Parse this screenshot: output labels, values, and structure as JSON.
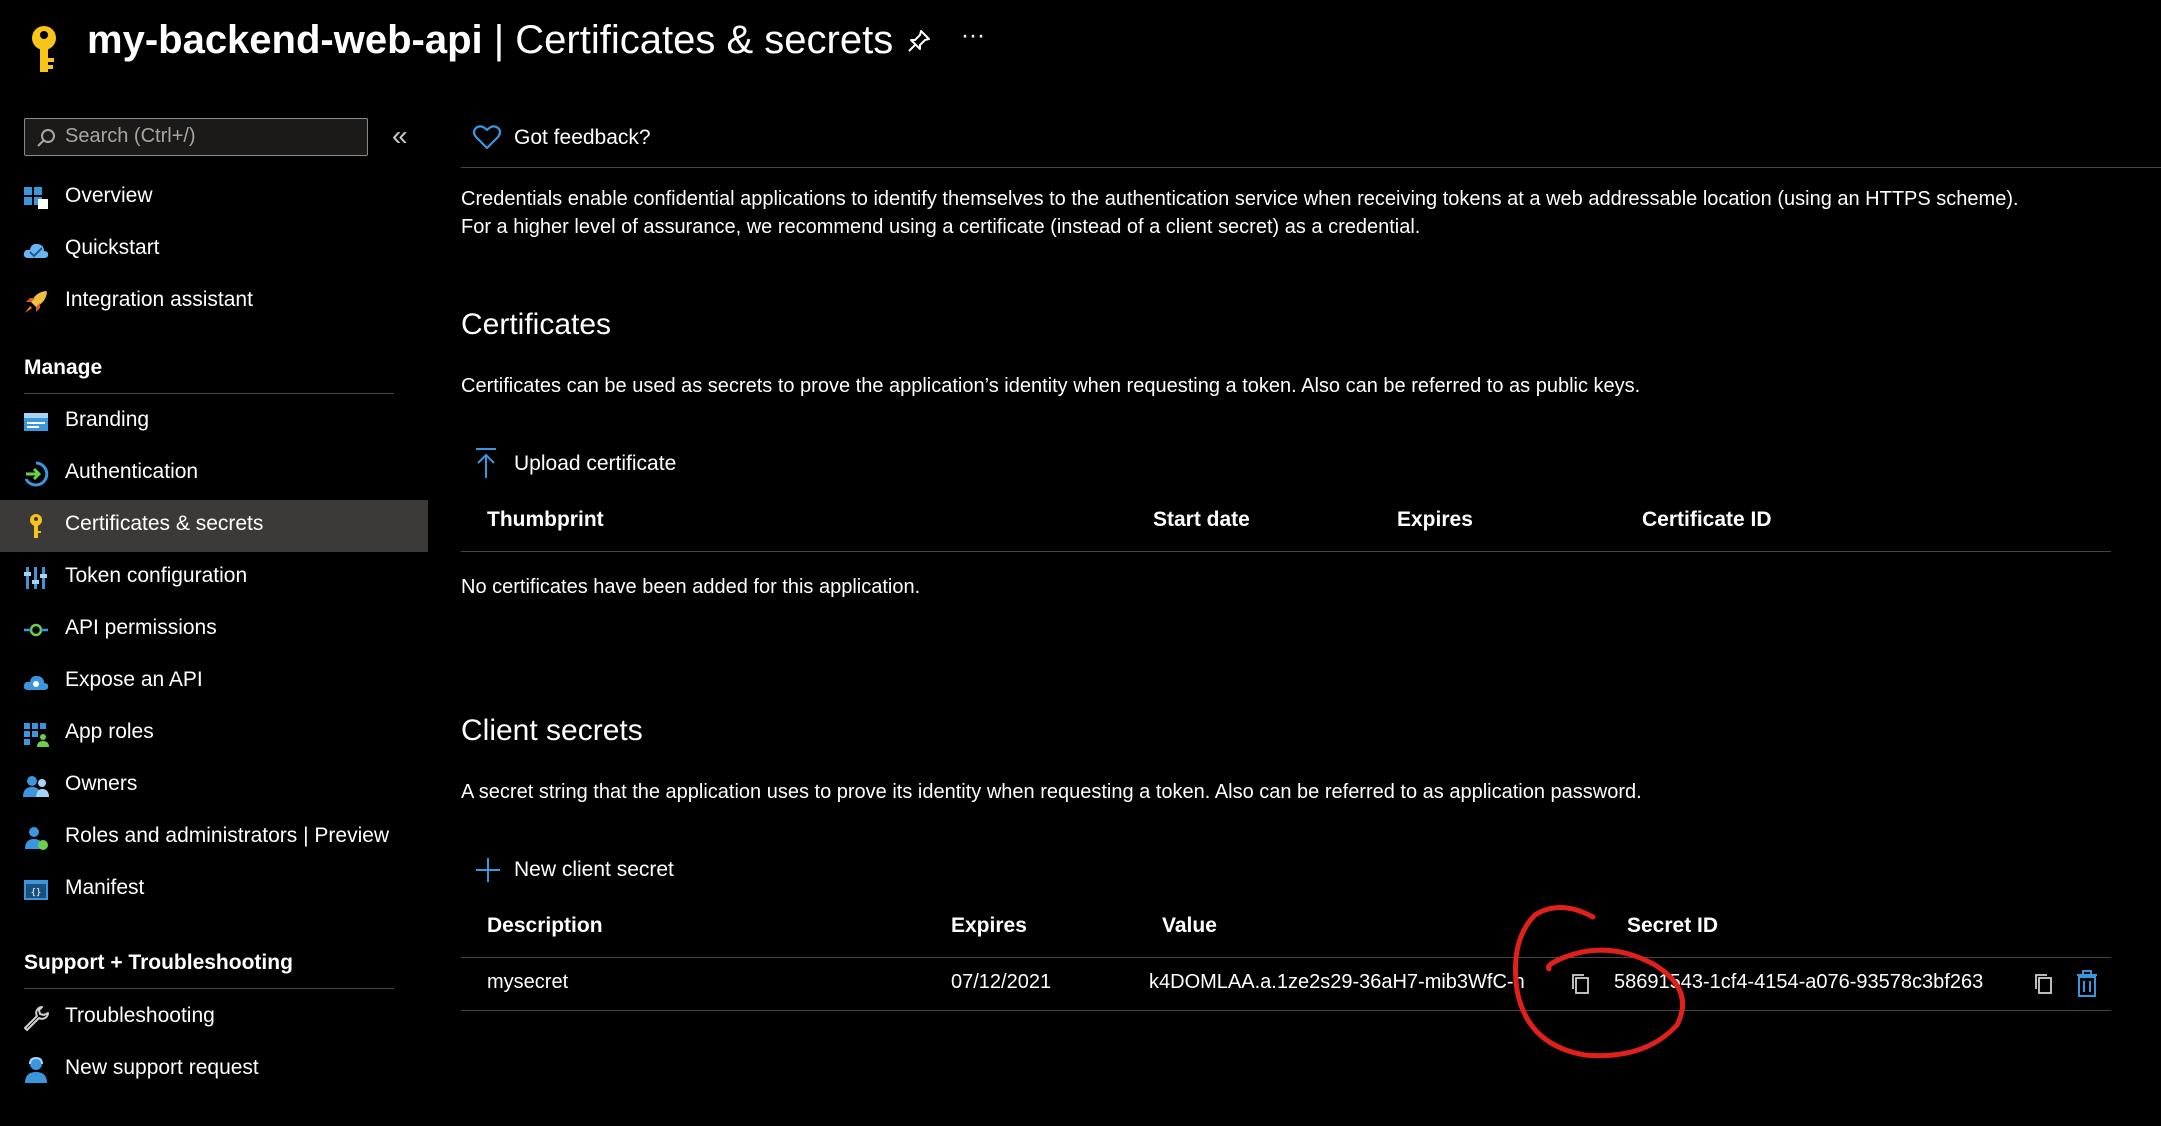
{
  "header": {
    "app_name": "my-backend-web-api",
    "separator": "|",
    "page_title": "Certificates & secrets",
    "pin_icon": "pin-icon",
    "more_icon": "more-icon",
    "more_glyph": "···"
  },
  "sidebar": {
    "search_placeholder": "Search (Ctrl+/)",
    "collapse_glyph": "«",
    "top_items": [
      {
        "label": "Overview",
        "icon": "overview-icon"
      },
      {
        "label": "Quickstart",
        "icon": "quickstart-cloud-icon"
      },
      {
        "label": "Integration assistant",
        "icon": "rocket-icon"
      }
    ],
    "manage_header": "Manage",
    "manage_items": [
      {
        "label": "Branding",
        "icon": "branding-icon"
      },
      {
        "label": "Authentication",
        "icon": "authentication-icon"
      },
      {
        "label": "Certificates & secrets",
        "icon": "key-icon",
        "active": true
      },
      {
        "label": "Token configuration",
        "icon": "token-config-icon"
      },
      {
        "label": "API permissions",
        "icon": "api-permissions-icon"
      },
      {
        "label": "Expose an API",
        "icon": "expose-api-cloud-icon"
      },
      {
        "label": "App roles",
        "icon": "app-roles-icon"
      },
      {
        "label": "Owners",
        "icon": "owners-icon"
      },
      {
        "label": "Roles and administrators | Preview",
        "icon": "roles-admin-icon"
      },
      {
        "label": "Manifest",
        "icon": "manifest-icon"
      }
    ],
    "support_header": "Support + Troubleshooting",
    "support_items": [
      {
        "label": "Troubleshooting",
        "icon": "wrench-icon"
      },
      {
        "label": "New support request",
        "icon": "support-person-icon"
      }
    ]
  },
  "main": {
    "feedback_label": "Got feedback?",
    "intro": "Credentials enable confidential applications to identify themselves to the authentication service when receiving tokens at a web addressable location (using an HTTPS scheme). For a higher level of assurance, we recommend using a certificate (instead of a client secret) as a credential.",
    "certificates": {
      "heading": "Certificates",
      "description": "Certificates can be used as secrets to prove the application’s identity when requesting a token. Also can be referred to as public keys.",
      "upload_label": "Upload certificate",
      "columns": [
        "Thumbprint",
        "Start date",
        "Expires",
        "Certificate ID"
      ],
      "empty_text": "No certificates have been added for this application."
    },
    "client_secrets": {
      "heading": "Client secrets",
      "description": "A secret string that the application uses to prove its identity when requesting a token. Also can be referred to as application password.",
      "new_label": "New client secret",
      "columns": [
        "Description",
        "Expires",
        "Value",
        "Secret ID"
      ],
      "rows": [
        {
          "description": "mysecret",
          "expires": "07/12/2021",
          "value": "k4DOMLAA.a.1ze2s29-36aH7-mib3WfC-h",
          "secret_id": "58691543-1cf4-4154-a076-93578c3bf263"
        }
      ]
    }
  },
  "colors": {
    "accent": "#3a96dd",
    "annotation": "#e0201b",
    "active_bg": "#3b3a39"
  }
}
